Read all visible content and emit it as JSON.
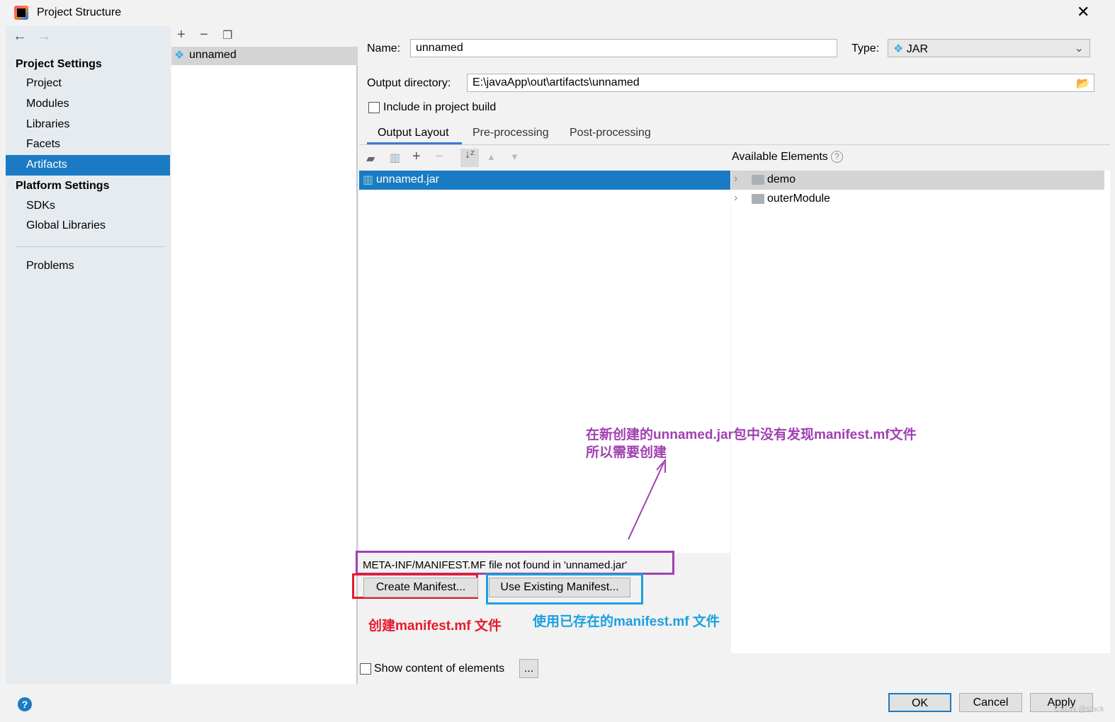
{
  "window": {
    "title": "Project Structure",
    "close_icon": "close-icon"
  },
  "sidebar": {
    "project_settings_header": "Project Settings",
    "items": [
      {
        "label": "Project"
      },
      {
        "label": "Modules"
      },
      {
        "label": "Libraries"
      },
      {
        "label": "Facets"
      },
      {
        "label": "Artifacts",
        "selected": true
      }
    ],
    "platform_settings_header": "Platform Settings",
    "platform_items": [
      {
        "label": "SDKs"
      },
      {
        "label": "Global Libraries"
      }
    ],
    "problems": "Problems"
  },
  "artifact_list": {
    "items": [
      {
        "label": "unnamed",
        "selected": true
      }
    ]
  },
  "form": {
    "name_label": "Name:",
    "name_value": "unnamed",
    "type_label": "Type:",
    "type_value": "JAR",
    "output_dir_label": "Output directory:",
    "output_dir_value": "E:\\javaApp\\out\\artifacts\\unnamed",
    "include_in_build": "Include in project build",
    "include_checked": false
  },
  "tabs": [
    {
      "label": "Output Layout",
      "active": true
    },
    {
      "label": "Pre-processing"
    },
    {
      "label": "Post-processing"
    }
  ],
  "layout_tree": {
    "items": [
      {
        "label": "unnamed.jar",
        "selected": true
      }
    ]
  },
  "available": {
    "title": "Available Elements",
    "items": [
      {
        "label": "demo",
        "selected": true
      },
      {
        "label": "outerModule"
      }
    ]
  },
  "manifest": {
    "message": "META-INF/MANIFEST.MF file not found in 'unnamed.jar'",
    "create": "Create Manifest...",
    "use_existing": "Use Existing Manifest..."
  },
  "show_content": {
    "label": "Show content of elements",
    "checked": false,
    "more": "..."
  },
  "footer": {
    "ok": "OK",
    "cancel": "Cancel",
    "apply": "Apply",
    "watermark": "CSDN @slack"
  },
  "annotations": {
    "purple_line1": "在新创建的unnamed.jar包中没有发现manifest.mf文件",
    "purple_line2": "所以需要创建",
    "red": "创建manifest.mf 文件",
    "blue": "使用已存在的manifest.mf 文件",
    "colors": {
      "purple": "#a040b0",
      "red": "#e8192c",
      "blue": "#1aa0e0"
    }
  },
  "colors": {
    "selection": "#1a7bc4",
    "sidebar_bg": "#e6ebf0"
  }
}
